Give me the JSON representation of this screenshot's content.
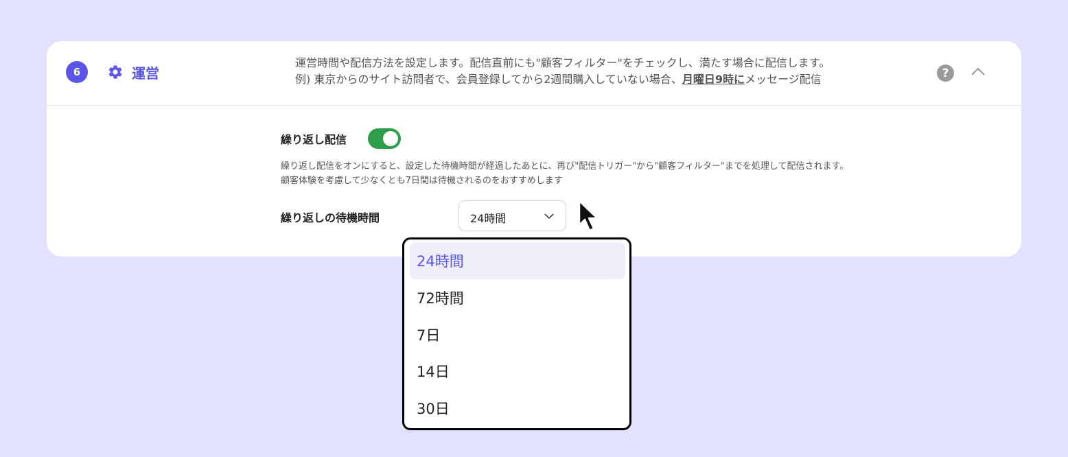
{
  "section": {
    "step_number": "6",
    "title": "運営",
    "description_line1": "運営時間や配信方法を設定します。配信直前にも\"顧客フィルター\"をチェックし、満たす場合に配信します。",
    "description_line2_prefix": "例) 東京からのサイト訪問者で、会員登録してから2週間購入していない場合、",
    "description_line2_emphasis": "月曜日9時に",
    "description_line2_suffix": "メッセージ配信",
    "help_icon_label": "?"
  },
  "repeat": {
    "label": "繰り返し配信",
    "toggle_on": true,
    "toggle_color": "#2f9e4a",
    "description_line1": "繰り返し配信をオンにすると、設定した待機時間が経過したあとに、再び\"配信トリガー\"から\"顧客フィルター\"までを処理して配信されます。",
    "description_line2": "顧客体験を考慮して少なくとも7日間は待機されるのをおすすめします"
  },
  "wait_time": {
    "label": "繰り返しの待機時間",
    "selected_value": "24時間",
    "options": [
      "24時間",
      "72時間",
      "7日",
      "14日",
      "30日"
    ],
    "selected_index": 0
  },
  "colors": {
    "accent": "#5a55e8",
    "background": "#e2e2ff"
  },
  "icons": {
    "step": "step-number-badge",
    "section": "gear-icon",
    "help": "question-circle-icon",
    "collapse": "chevron-up-icon",
    "select": "chevron-down-icon",
    "cursor": "mouse-pointer-icon"
  }
}
